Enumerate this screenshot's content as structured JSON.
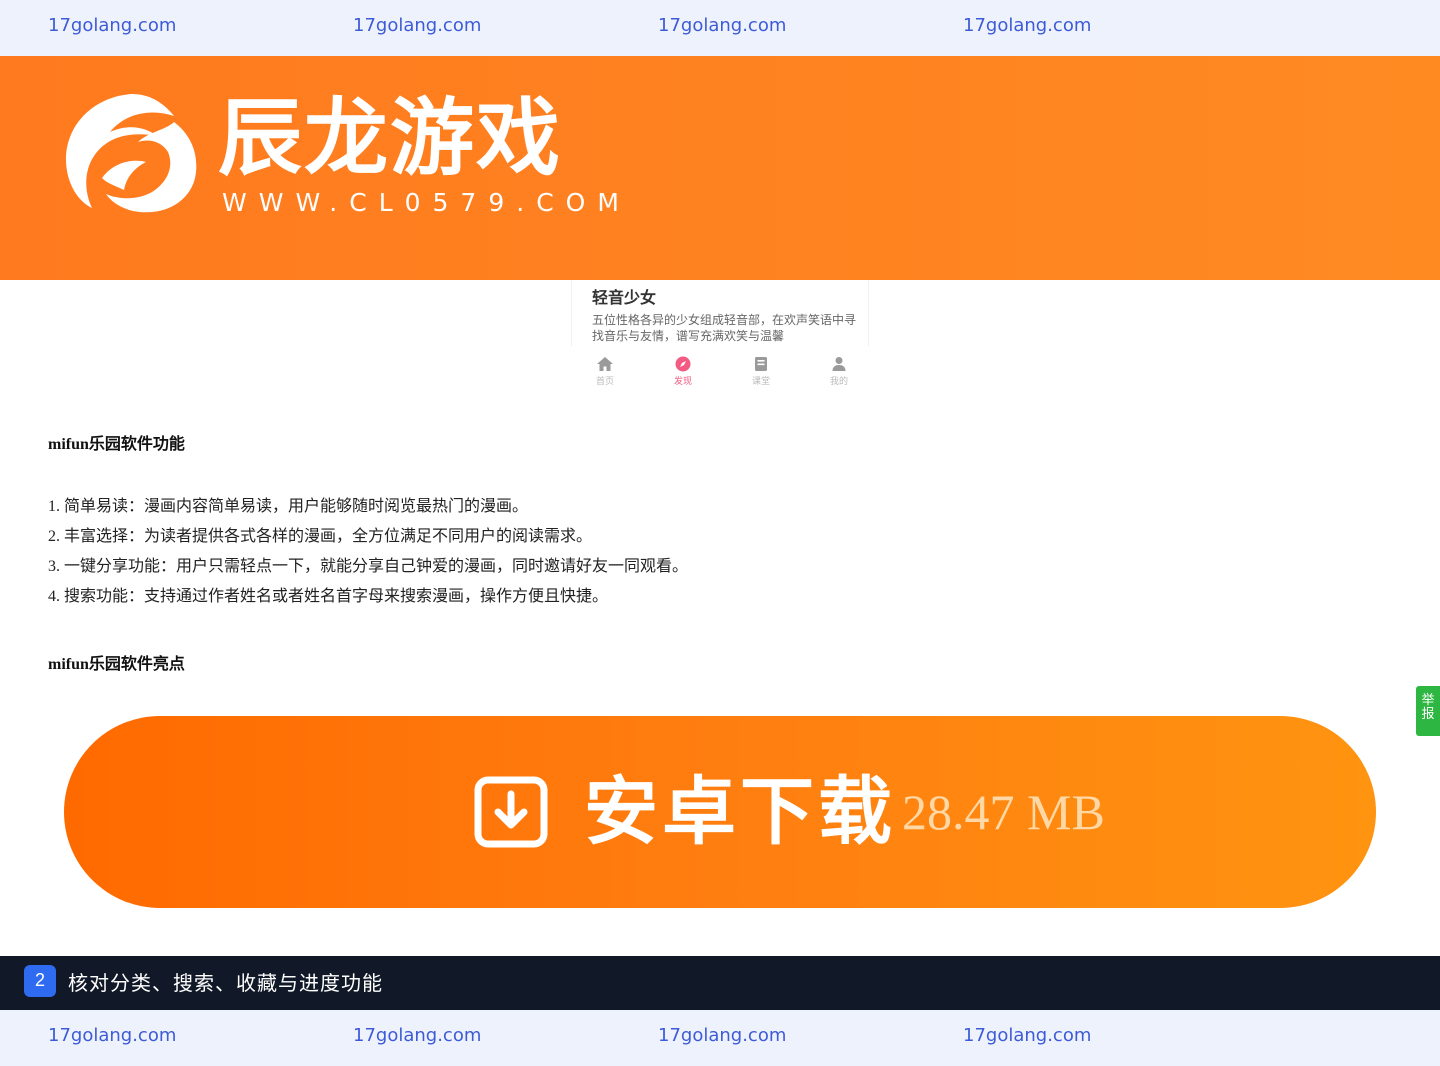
{
  "watermark": {
    "top": [
      "17golang.com",
      "17golang.com",
      "17golang.com",
      "17golang.com"
    ],
    "bottom": [
      "17golang.com",
      "17golang.com",
      "17golang.com",
      "17golang.com"
    ]
  },
  "banner": {
    "name": "辰龙游戏",
    "url": "WWW.CL0579.COM"
  },
  "app_preview": {
    "title": "轻音少女",
    "description": "五位性格各异的少女组成轻音部，在欢声笑语中寻找音乐与友情，谱写充满欢笑与温馨",
    "nav": [
      {
        "label": "首页",
        "icon": "home-icon"
      },
      {
        "label": "发现",
        "icon": "compass-icon"
      },
      {
        "label": "课堂",
        "icon": "book-icon"
      },
      {
        "label": "我的",
        "icon": "user-icon"
      }
    ],
    "active_color": "#f25b82"
  },
  "article": {
    "features_heading": "mifun乐园软件功能",
    "features": [
      "1. 简单易读：漫画内容简单易读，用户能够随时阅览最热门的漫画。",
      "2. 丰富选择：为读者提供各式各样的漫画，全方位满足不同用户的阅读需求。",
      "3. 一键分享功能：用户只需轻点一下，就能分享自己钟爱的漫画，同时邀请好友一同观看。",
      "4. 搜索功能：支持通过作者姓名或者姓名首字母来搜索漫画，操作方便且快捷。"
    ],
    "highlights_heading": "mifun乐园软件亮点"
  },
  "report_tab": "举报",
  "download": {
    "label": "安卓下载",
    "size": "28.47 MB"
  },
  "step_bar": {
    "number": "2",
    "text": "核对分类、搜索、收藏与进度功能"
  },
  "colors": {
    "brand_orange": "#ff7a1e",
    "watermark_text": "#3d5bd6",
    "dark_bar": "#111827",
    "report_green": "#2db742"
  }
}
